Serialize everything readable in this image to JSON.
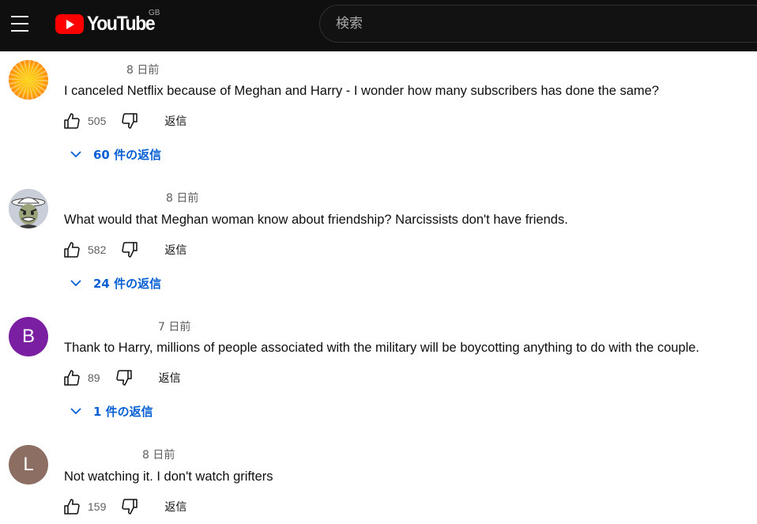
{
  "header": {
    "logo_text": "YouTube",
    "country_code": "GB",
    "search_placeholder": "検索"
  },
  "labels": {
    "reply": "返信"
  },
  "comments": [
    {
      "avatar_letter": "",
      "timestamp": "8 日前",
      "text": "I canceled Netflix because of Meghan and Harry - I wonder how many subscribers has done the same?",
      "likes": "505",
      "replies_label": "60 件の返信"
    },
    {
      "avatar_letter": "",
      "timestamp": "8 日前",
      "text": "What would that Meghan woman know about friendship? Narcissists don't have friends.",
      "likes": "582",
      "replies_label": "24 件の返信"
    },
    {
      "avatar_letter": "B",
      "timestamp": "7 日前",
      "text": "Thank to Harry, millions of people associated with the military will be boycotting anything to do with the couple.",
      "likes": "89",
      "replies_label": "1 件の返信"
    },
    {
      "avatar_letter": "L",
      "timestamp": "8 日前",
      "text": "Not watching it. I don't watch grifters",
      "likes": "159"
    }
  ],
  "colors": {
    "header_bg": "#0f0f0f",
    "brand_red": "#ff0000",
    "link_blue": "#065fd4",
    "avatar_b": "#7b1fa2",
    "avatar_l": "#8d6e63"
  }
}
